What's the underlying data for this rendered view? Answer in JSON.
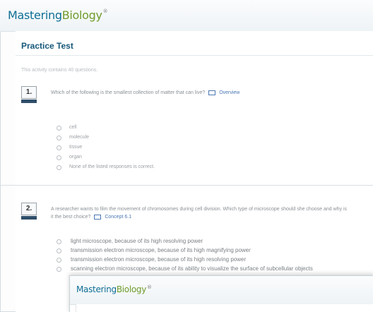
{
  "app": {
    "brand_part1": "Mastering",
    "brand_part2": "Biology",
    "brand_reg": "®"
  },
  "page": {
    "title": "Practice Test",
    "intro": "This activity contains 40 questions."
  },
  "questions": [
    {
      "number": "1.",
      "text": "Which of the following is the smallest collection of matter that can live?",
      "link_text": "Overview",
      "options": [
        "cell",
        "molecule",
        "tissue",
        "organ",
        "None of the listed responses is correct."
      ]
    },
    {
      "number": "2.",
      "text": "A researcher wants to film the movement of chromosomes during cell division. Which type of microscope should she choose and why is it the best choice?",
      "link_text": "Concept 6.1",
      "options": [
        "light microscope, because of its high resolving power",
        "transmission electron microscope, because of its high magnifying power",
        "transmission electron microscope, because of its high resolving power",
        "scanning electron microscope, because of its ability to visualize the surface of subcellular objects"
      ]
    }
  ],
  "overlay": {
    "brand_part1": "Mastering",
    "brand_part2": "Biology",
    "brand_reg": "®"
  },
  "colors": {
    "brand_blue": "#0f6e96",
    "brand_green": "#6f9c2c",
    "title_blue": "#15587a",
    "badge_dark": "#2f4e6a",
    "link_blue": "#4a77b4"
  },
  "icons": {
    "question_link": "reference-link-icon",
    "option": "radio-button"
  }
}
